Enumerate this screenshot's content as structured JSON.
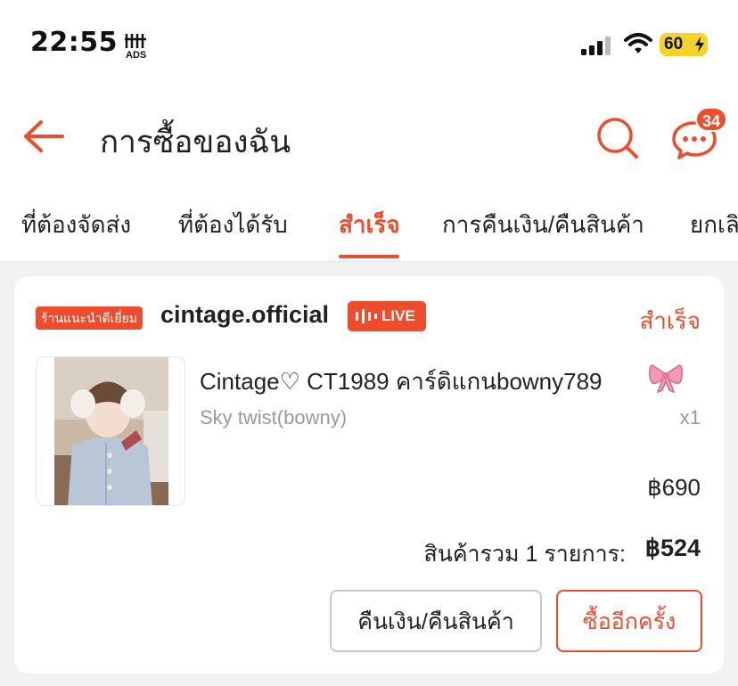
{
  "status_bar": {
    "time": "22:55",
    "battery": "60"
  },
  "header": {
    "title": "การซื้อของฉัน",
    "chat_badge": "34"
  },
  "tabs": [
    {
      "label": "ที่ต้องจัดส่ง"
    },
    {
      "label": "ที่ต้องได้รับ"
    },
    {
      "label": "สำเร็จ"
    },
    {
      "label": "การคืนเงิน/คืนสินค้า"
    },
    {
      "label": "ยกเลิก"
    }
  ],
  "order": {
    "shop_badge": "ร้านแนะนำดีเยี่ยม",
    "shop_name": "cintage.official",
    "live_label": "LIVE",
    "status": "สำเร็จ",
    "product": {
      "title": "Cintage♡ CT1989 คาร์ดิแกนbowny789",
      "variant": "Sky twist(bowny)",
      "quantity": "x1",
      "price": "฿690"
    },
    "total_label": "สินค้ารวม 1 รายการ:",
    "total_value": "฿524",
    "buttons": {
      "return": "คืนเงิน/คืนสินค้า",
      "rebuy": "ซื้ออีกครั้ง"
    }
  },
  "colors": {
    "accent": "#ee4d2d",
    "battery": "#f5d327"
  },
  "icons": [
    "back-arrow-icon",
    "search-icon",
    "chat-icon",
    "live-icon",
    "bow-icon",
    "signal-icon",
    "wifi-icon",
    "battery-icon"
  ]
}
